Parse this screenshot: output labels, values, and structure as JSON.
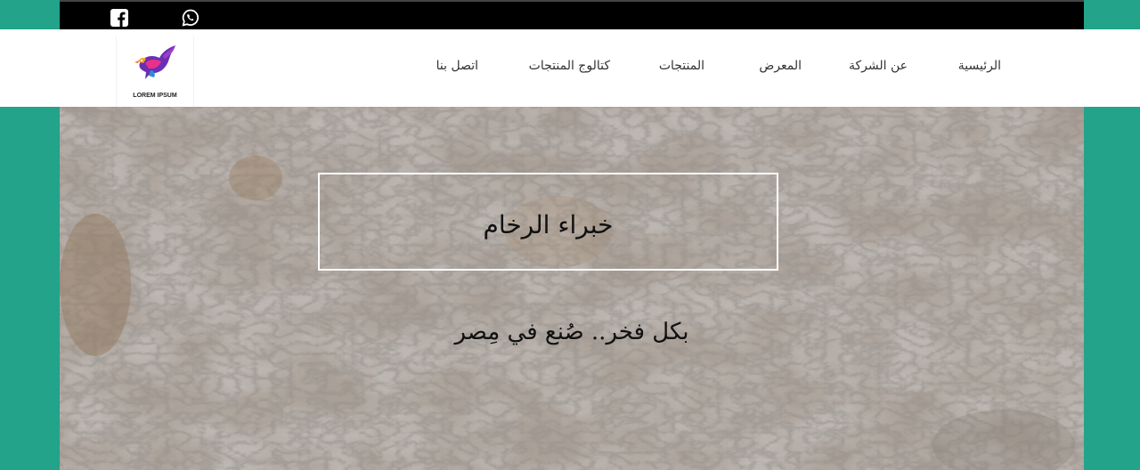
{
  "topbar": {
    "social": [
      {
        "icon": "facebook-icon"
      },
      {
        "icon": "whatsapp-icon"
      }
    ]
  },
  "header": {
    "logo_text": "LOREM IPSUM",
    "nav": {
      "home": "الرئيسية",
      "about": "عن الشركة",
      "gallery": "المعرض",
      "products": "المنتجات",
      "catalog": "كتالوج المنتجات",
      "contact": "اتصل بنا"
    }
  },
  "hero": {
    "title": "خبراء الرخام",
    "subtitle": "بكل فخر.. صُنع في مِصر"
  },
  "colors": {
    "accent": "#22a38a",
    "topbar": "#000000",
    "header_bg": "#ffffff"
  }
}
